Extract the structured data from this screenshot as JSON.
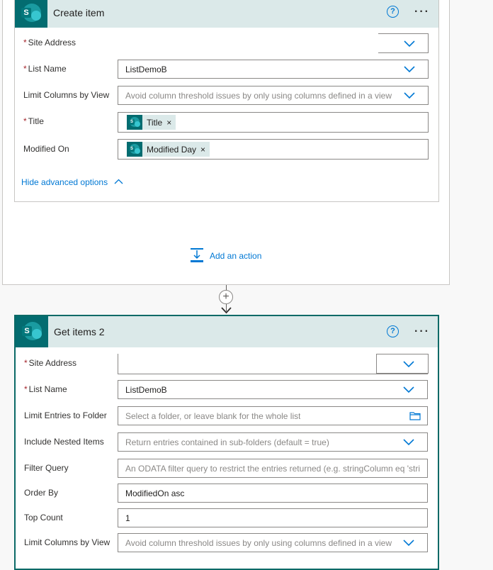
{
  "create_item": {
    "title": "Create item",
    "help": "?",
    "more": "···",
    "fields": {
      "site_address": {
        "label": "Site Address",
        "required": "*",
        "value": ""
      },
      "list_name": {
        "label": "List Name",
        "required": "*",
        "value": "ListDemoB"
      },
      "limit_columns": {
        "label": "Limit Columns by View",
        "placeholder": "Avoid column threshold issues by only using columns defined in a view"
      },
      "title": {
        "label": "Title",
        "required": "*",
        "token": "Title",
        "token_remove": "×"
      },
      "modified_on": {
        "label": "Modified On",
        "token": "Modified Day",
        "token_remove": "×"
      }
    },
    "hide_advanced": "Hide advanced options"
  },
  "add_action": {
    "label": "Add an action"
  },
  "connector": {
    "plus": "+"
  },
  "get_items": {
    "title": "Get items 2",
    "help": "?",
    "more": "···",
    "fields": {
      "site_address": {
        "label": "Site Address",
        "required": "*",
        "value": ""
      },
      "list_name": {
        "label": "List Name",
        "required": "*",
        "value": "ListDemoB"
      },
      "limit_entries": {
        "label": "Limit Entries to Folder",
        "placeholder": "Select a folder, or leave blank for the whole list"
      },
      "include_nested": {
        "label": "Include Nested Items",
        "placeholder": "Return entries contained in sub-folders (default = true)"
      },
      "filter_query": {
        "label": "Filter Query",
        "placeholder": "An ODATA filter query to restrict the entries returned (e.g. stringColumn eq 'stri"
      },
      "order_by": {
        "label": "Order By",
        "value": "ModifiedOn asc"
      },
      "top_count": {
        "label": "Top Count",
        "value": "1"
      },
      "limit_columns": {
        "label": "Limit Columns by View",
        "placeholder": "Avoid column threshold issues by only using columns defined in a view"
      }
    }
  },
  "colors": {
    "accent": "#0078d4",
    "header_bg": "#dbe9e9",
    "sharepoint": "#036c70",
    "required": "#a4262c"
  },
  "icons": [
    "sharepoint-icon",
    "help-icon",
    "more-icon",
    "chevron-down-icon",
    "chevron-up-icon",
    "add-action-icon",
    "folder-icon",
    "plus-icon",
    "arrow-down-icon"
  ]
}
